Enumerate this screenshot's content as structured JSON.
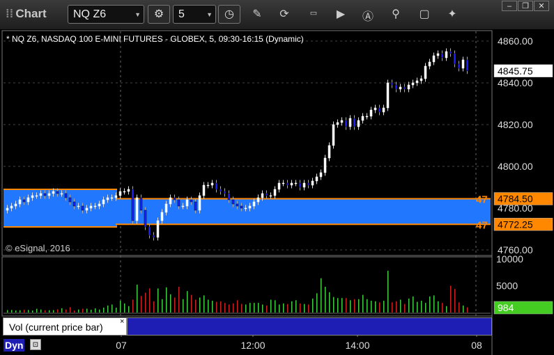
{
  "toolbar": {
    "app_title": "Chart",
    "symbol": "NQ Z6",
    "interval": "5",
    "icons": [
      "settings-gear-icon",
      "clock-icon",
      "pencil-icon",
      "refresh-icon",
      "get-icon",
      "play-icon",
      "alert-icon",
      "link-icon",
      "chat-icon",
      "twitter-icon"
    ],
    "window_buttons": [
      "minimize-icon",
      "restore-icon",
      "close-icon"
    ]
  },
  "chart_header": "* NQ Z6, NASDAQ 100 E-MINI FUTURES - GLOBEX, 5, 09:30-16:15 (Dynamic)",
  "copyright": "© eSignal, 2016",
  "price_axis_labels": [
    "4860.00",
    "4840.00",
    "4820.00",
    "4800.00",
    "4780.00",
    "4760.00"
  ],
  "volume_axis_labels": [
    "10000",
    "5000"
  ],
  "time_axis_labels": [
    "07",
    "12:00",
    "14:00",
    "08"
  ],
  "price_markers": {
    "last": "4845.75",
    "upper_level": "4784.50",
    "lower_level": "4772.25",
    "level_tag": "47",
    "volume_last": "984"
  },
  "volume_study_label": "Vol (current price bar)",
  "dyn_label": "Dyn",
  "colors": {
    "up_candle": "#ffffff",
    "down_candle": "#2020ff",
    "band_fill": "#2277ff",
    "level_line": "#ff8800",
    "vol_up": "#44cc44",
    "vol_down": "#cc2222",
    "vol_marker": "#44cc22"
  },
  "chart_data": {
    "type": "candlestick",
    "title": "NQ Z6, NASDAQ 100 E-MINI FUTURES - GLOBEX, 5, 09:30-16:15 (Dynamic)",
    "ylim": [
      4756,
      4870
    ],
    "volume_ylim": [
      0,
      10500
    ],
    "levels": [
      4784.5,
      4772.25
    ],
    "prev_day_band": [
      4789,
      4771
    ],
    "close": [
      4780,
      4781,
      4782,
      4784,
      4783,
      4785,
      4786,
      4786,
      4787,
      4786,
      4787,
      4788,
      4787,
      4787,
      4785,
      4783,
      4781,
      4781,
      4779,
      4780,
      4781,
      4781,
      4782,
      4784,
      4785,
      4785,
      4786,
      4788,
      4788,
      4789,
      4774,
      4785,
      4779,
      4771,
      4767,
      4766,
      4774,
      4778,
      4782,
      4785,
      4784,
      4781,
      4781,
      4784,
      4783,
      4779,
      4786,
      4791,
      4791,
      4792,
      4789,
      4788,
      4787,
      4784,
      4782,
      4781,
      4780,
      4780,
      4781,
      4783,
      4785,
      4787,
      4786,
      4786,
      4789,
      4792,
      4792,
      4791,
      4792,
      4792,
      4790,
      4792,
      4791,
      4793,
      4795,
      4797,
      4804,
      4810,
      4820,
      4821,
      4822,
      4819,
      4823,
      4819,
      4822,
      4824,
      4824,
      4827,
      4828,
      4826,
      4828,
      4840,
      4839,
      4837,
      4838,
      4837,
      4839,
      4840,
      4841,
      4842,
      4848,
      4850,
      4853,
      4854,
      4852,
      4855,
      4854,
      4849,
      4847,
      4851,
      4845.75
    ],
    "volume": [
      450,
      480,
      400,
      430,
      520,
      480,
      380,
      700,
      560,
      430,
      430,
      450,
      600,
      800,
      570,
      1000,
      380,
      560,
      700,
      720,
      520,
      780,
      560,
      920,
      1300,
      1500,
      900,
      2200,
      1700,
      1200,
      2400,
      5200,
      3100,
      3700,
      4500,
      2100,
      4500,
      2500,
      4700,
      3400,
      2800,
      4800,
      2500,
      4000,
      3300,
      2400,
      2800,
      3200,
      2400,
      2200,
      2000,
      2100,
      1800,
      1500,
      1700,
      2300,
      1600,
      1500,
      1800,
      1800,
      1800,
      1500,
      1300,
      2400,
      2300,
      1500,
      1700,
      1600,
      2100,
      2300,
      1700,
      1600,
      1500,
      2600,
      3600,
      6400,
      4800,
      3800,
      2900,
      2700,
      2700,
      2700,
      2300,
      2500,
      2500,
      3300,
      2500,
      2200,
      2100,
      1900,
      2200,
      7800,
      1900,
      2100,
      2400,
      1600,
      2600,
      3000,
      2000,
      2200,
      1800,
      3000,
      3200,
      2100,
      1800,
      1200,
      5000,
      4400,
      1900,
      1300,
      984
    ],
    "price_labels": [
      "4860.00",
      "4840.00",
      "4820.00",
      "4800.00",
      "4780.00",
      "4760.00"
    ],
    "volume_labels": [
      "10000",
      "5000"
    ],
    "time_labels": [
      "07",
      "12:00",
      "14:00",
      "08"
    ],
    "last": 4845.75,
    "last_volume": 984
  }
}
